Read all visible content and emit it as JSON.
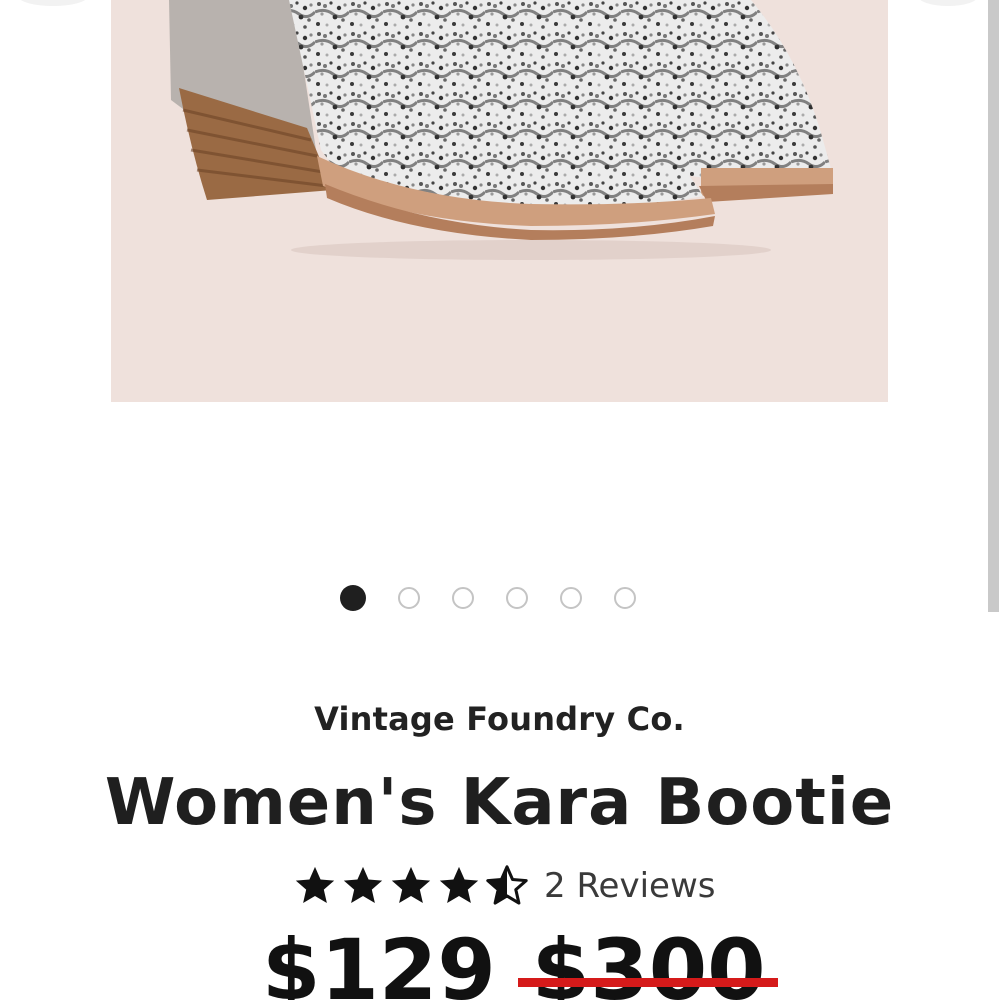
{
  "product": {
    "brand": "Vintage Foundry Co.",
    "title": "Women's Kara Bootie",
    "rating": 4.5,
    "rating_max": 5,
    "reviews_label": "2 Reviews",
    "price_current": "$129",
    "price_original": "$300"
  },
  "gallery": {
    "image_alt": "Snakeskin print bootie with grey suede panel and stacked wood heel",
    "slide_count": 6,
    "active_slide": 1
  },
  "colors": {
    "image_background": "#efe1dc",
    "strike": "#d51a1a",
    "text": "#1f1f1f"
  }
}
